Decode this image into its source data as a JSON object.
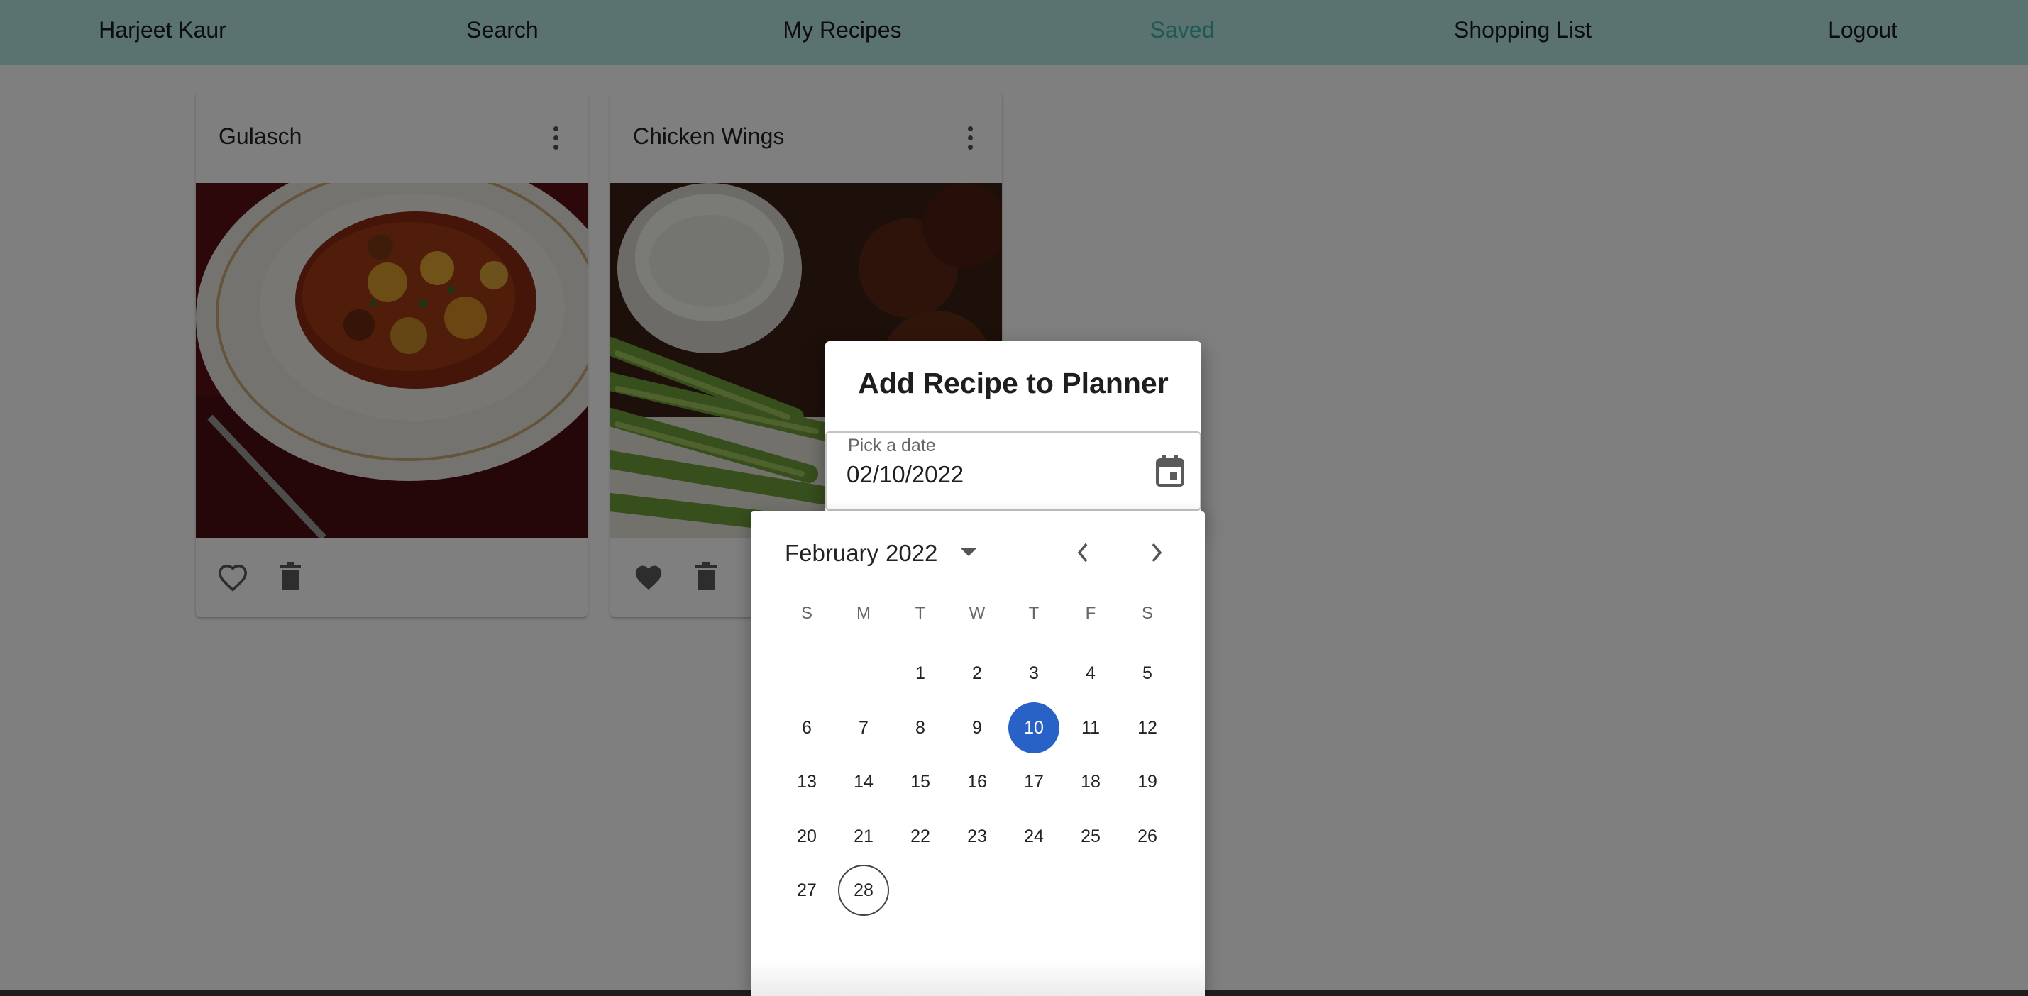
{
  "nav": {
    "user": "Harjeet Kaur",
    "search": "Search",
    "my_recipes": "My Recipes",
    "saved": "Saved",
    "shopping_list": "Shopping List",
    "logout": "Logout",
    "active": "Saved",
    "colors": {
      "bar": "#b4e4e0",
      "active": "#3eb3a7"
    }
  },
  "recipes": [
    {
      "title": "Gulasch",
      "favorited": false,
      "icons": [
        "more-vert-icon",
        "heart-outline-icon",
        "trash-icon"
      ]
    },
    {
      "title": "Chicken Wings",
      "favorited": true,
      "icons": [
        "more-vert-icon",
        "heart-filled-icon",
        "trash-icon"
      ]
    }
  ],
  "dialog": {
    "title": "Add Recipe to Planner",
    "date_label": "Pick a date",
    "date_value": "02/10/2022",
    "icon": "calendar-icon"
  },
  "calendar": {
    "month": "February",
    "year": "2022",
    "weekdays": [
      "S",
      "M",
      "T",
      "W",
      "T",
      "F",
      "S"
    ],
    "first_weekday_index": 2,
    "days_in_month": 28,
    "selected_day": 10,
    "today": 28,
    "colors": {
      "selected": "#2962c7"
    },
    "icons": [
      "dropdown-arrow-icon",
      "chevron-left-icon",
      "chevron-right-icon"
    ]
  }
}
